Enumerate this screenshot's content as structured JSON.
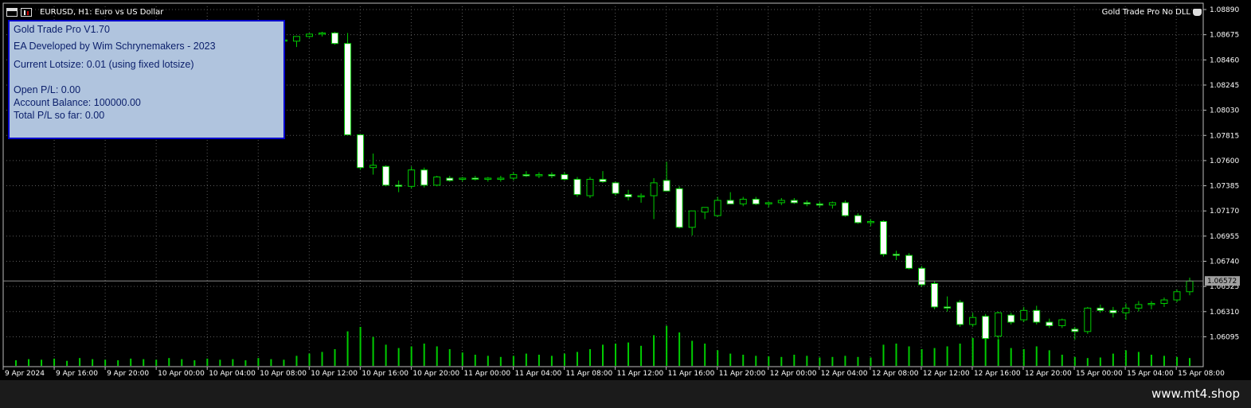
{
  "window": {
    "title": "EURUSD, H1:  Euro vs US Dollar",
    "ea_name": "Gold Trade Pro No DLL"
  },
  "panel": {
    "line1": "Gold Trade Pro V1.70",
    "line2": "EA Developed by Wim Schrynemakers - 2023",
    "line3": "Current Lotsize: 0.01 (using fixed lotsize)",
    "line4": "Open P/L: 0.00",
    "line5": "Account Balance: 100000.00",
    "line6": "Total P/L so far: 0.00"
  },
  "footer": {
    "site": "www.mt4.shop"
  },
  "colors": {
    "background": "#000000",
    "grid": "#5a5a5a",
    "bull": "#00cc00",
    "bear": "#ffffff",
    "panel": "#b0c4de",
    "panel_border": "#0000cc",
    "volume": "#00cc00"
  },
  "chart_data": {
    "type": "candlestick",
    "symbol": "EURUSD",
    "timeframe": "H1",
    "current_price": "1.06572",
    "y_ticks": [
      "1.08890",
      "1.08675",
      "1.08460",
      "1.08245",
      "1.08030",
      "1.07815",
      "1.07600",
      "1.07385",
      "1.07170",
      "1.06955",
      "1.06740",
      "1.06525",
      "1.06310",
      "1.06095"
    ],
    "x_labels": [
      "9 Apr 2024",
      "9 Apr 16:00",
      "9 Apr 20:00",
      "10 Apr 00:00",
      "10 Apr 04:00",
      "10 Apr 08:00",
      "10 Apr 12:00",
      "10 Apr 16:00",
      "10 Apr 20:00",
      "11 Apr 00:00",
      "11 Apr 04:00",
      "11 Apr 08:00",
      "11 Apr 12:00",
      "11 Apr 16:00",
      "11 Apr 20:00",
      "12 Apr 00:00",
      "12 Apr 04:00",
      "12 Apr 08:00",
      "12 Apr 12:00",
      "12 Apr 16:00",
      "12 Apr 20:00",
      "15 Apr 00:00",
      "15 Apr 04:00",
      "15 Apr 08:00"
    ],
    "ylim": [
      1.0598,
      1.0895
    ],
    "candles": [
      {
        "o": 1.0863,
        "h": 1.0865,
        "l": 1.086,
        "c": 1.0861
      },
      {
        "o": 1.0862,
        "h": 1.0864,
        "l": 1.086,
        "c": 1.0863
      },
      {
        "o": 1.0863,
        "h": 1.0866,
        "l": 1.0861,
        "c": 1.0862
      },
      {
        "o": 1.0862,
        "h": 1.0864,
        "l": 1.086,
        "c": 1.0863
      },
      {
        "o": 1.0863,
        "h": 1.0865,
        "l": 1.0861,
        "c": 1.0862
      },
      {
        "o": 1.0862,
        "h": 1.0864,
        "l": 1.086,
        "c": 1.0863
      },
      {
        "o": 1.0863,
        "h": 1.0865,
        "l": 1.0861,
        "c": 1.0862
      },
      {
        "o": 1.0862,
        "h": 1.0864,
        "l": 1.086,
        "c": 1.0863
      },
      {
        "o": 1.0863,
        "h": 1.0865,
        "l": 1.0861,
        "c": 1.0862
      },
      {
        "o": 1.0862,
        "h": 1.0864,
        "l": 1.086,
        "c": 1.0863
      },
      {
        "o": 1.0863,
        "h": 1.0865,
        "l": 1.0861,
        "c": 1.0862
      },
      {
        "o": 1.0862,
        "h": 1.0864,
        "l": 1.086,
        "c": 1.0863
      },
      {
        "o": 1.0863,
        "h": 1.0865,
        "l": 1.0861,
        "c": 1.0862
      },
      {
        "o": 1.0862,
        "h": 1.0864,
        "l": 1.086,
        "c": 1.0863
      },
      {
        "o": 1.0863,
        "h": 1.0865,
        "l": 1.0861,
        "c": 1.0862
      },
      {
        "o": 1.0862,
        "h": 1.0864,
        "l": 1.086,
        "c": 1.0863
      },
      {
        "o": 1.0863,
        "h": 1.0865,
        "l": 1.0861,
        "c": 1.0862
      },
      {
        "o": 1.0862,
        "h": 1.0864,
        "l": 1.086,
        "c": 1.0863
      },
      {
        "o": 1.0863,
        "h": 1.0865,
        "l": 1.0861,
        "c": 1.0862
      },
      {
        "o": 1.0862,
        "h": 1.0864,
        "l": 1.086,
        "c": 1.0863
      },
      {
        "o": 1.0863,
        "h": 1.0865,
        "l": 1.0861,
        "c": 1.0862
      },
      {
        "o": 1.0862,
        "h": 1.0864,
        "l": 1.086,
        "c": 1.0863
      },
      {
        "o": 1.0862,
        "h": 1.0866,
        "l": 1.0857,
        "c": 1.0866
      },
      {
        "o": 1.0866,
        "h": 1.0869,
        "l": 1.0865,
        "c": 1.0868
      },
      {
        "o": 1.0868,
        "h": 1.087,
        "l": 1.0866,
        "c": 1.0869
      },
      {
        "o": 1.0869,
        "h": 1.087,
        "l": 1.0859,
        "c": 1.086
      },
      {
        "o": 1.086,
        "h": 1.0869,
        "l": 1.0782,
        "c": 1.0782
      },
      {
        "o": 1.0782,
        "h": 1.0782,
        "l": 1.0752,
        "c": 1.0754
      },
      {
        "o": 1.0754,
        "h": 1.0766,
        "l": 1.0748,
        "c": 1.0756
      },
      {
        "o": 1.0755,
        "h": 1.0756,
        "l": 1.0738,
        "c": 1.0739
      },
      {
        "o": 1.0739,
        "h": 1.0743,
        "l": 1.0733,
        "c": 1.0738
      },
      {
        "o": 1.0738,
        "h": 1.0755,
        "l": 1.0736,
        "c": 1.0752
      },
      {
        "o": 1.0752,
        "h": 1.0754,
        "l": 1.0737,
        "c": 1.0739
      },
      {
        "o": 1.0739,
        "h": 1.0747,
        "l": 1.0738,
        "c": 1.0746
      },
      {
        "o": 1.0745,
        "h": 1.0747,
        "l": 1.0742,
        "c": 1.0743
      },
      {
        "o": 1.0744,
        "h": 1.0746,
        "l": 1.0742,
        "c": 1.0745
      },
      {
        "o": 1.0745,
        "h": 1.0747,
        "l": 1.0743,
        "c": 1.0744
      },
      {
        "o": 1.0744,
        "h": 1.0746,
        "l": 1.0742,
        "c": 1.0745
      },
      {
        "o": 1.0744,
        "h": 1.0747,
        "l": 1.0742,
        "c": 1.0745
      },
      {
        "o": 1.0745,
        "h": 1.075,
        "l": 1.0743,
        "c": 1.0748
      },
      {
        "o": 1.0748,
        "h": 1.0751,
        "l": 1.0746,
        "c": 1.0747
      },
      {
        "o": 1.0747,
        "h": 1.075,
        "l": 1.0745,
        "c": 1.0748
      },
      {
        "o": 1.0748,
        "h": 1.075,
        "l": 1.0745,
        "c": 1.0747
      },
      {
        "o": 1.0748,
        "h": 1.075,
        "l": 1.0743,
        "c": 1.0744
      },
      {
        "o": 1.0744,
        "h": 1.0746,
        "l": 1.0729,
        "c": 1.0731
      },
      {
        "o": 1.073,
        "h": 1.0746,
        "l": 1.0728,
        "c": 1.0744
      },
      {
        "o": 1.0744,
        "h": 1.0751,
        "l": 1.0741,
        "c": 1.0742
      },
      {
        "o": 1.0741,
        "h": 1.0742,
        "l": 1.073,
        "c": 1.0732
      },
      {
        "o": 1.0731,
        "h": 1.0735,
        "l": 1.0726,
        "c": 1.0729
      },
      {
        "o": 1.0729,
        "h": 1.0732,
        "l": 1.0724,
        "c": 1.073
      },
      {
        "o": 1.073,
        "h": 1.0745,
        "l": 1.071,
        "c": 1.0741
      },
      {
        "o": 1.0743,
        "h": 1.0759,
        "l": 1.0735,
        "c": 1.0734
      },
      {
        "o": 1.0736,
        "h": 1.0738,
        "l": 1.0702,
        "c": 1.0703
      },
      {
        "o": 1.0703,
        "h": 1.0716,
        "l": 1.0696,
        "c": 1.0717
      },
      {
        "o": 1.0716,
        "h": 1.0718,
        "l": 1.071,
        "c": 1.072
      },
      {
        "o": 1.0713,
        "h": 1.0729,
        "l": 1.0712,
        "c": 1.0726
      },
      {
        "o": 1.0726,
        "h": 1.0733,
        "l": 1.0723,
        "c": 1.0723
      },
      {
        "o": 1.0723,
        "h": 1.0729,
        "l": 1.0721,
        "c": 1.0727
      },
      {
        "o": 1.0727,
        "h": 1.0729,
        "l": 1.0722,
        "c": 1.0723
      },
      {
        "o": 1.0723,
        "h": 1.0725,
        "l": 1.072,
        "c": 1.0724
      },
      {
        "o": 1.0724,
        "h": 1.0728,
        "l": 1.0722,
        "c": 1.0726
      },
      {
        "o": 1.0726,
        "h": 1.0728,
        "l": 1.0723,
        "c": 1.0724
      },
      {
        "o": 1.0724,
        "h": 1.0726,
        "l": 1.0721,
        "c": 1.0723
      },
      {
        "o": 1.0723,
        "h": 1.0725,
        "l": 1.072,
        "c": 1.0722
      },
      {
        "o": 1.0722,
        "h": 1.0725,
        "l": 1.0719,
        "c": 1.0724
      },
      {
        "o": 1.0724,
        "h": 1.0726,
        "l": 1.0712,
        "c": 1.0713
      },
      {
        "o": 1.0713,
        "h": 1.0715,
        "l": 1.0706,
        "c": 1.0707
      },
      {
        "o": 1.0707,
        "h": 1.071,
        "l": 1.0704,
        "c": 1.0708
      },
      {
        "o": 1.0708,
        "h": 1.0709,
        "l": 1.0678,
        "c": 1.068
      },
      {
        "o": 1.068,
        "h": 1.0683,
        "l": 1.0675,
        "c": 1.0679
      },
      {
        "o": 1.0679,
        "h": 1.0681,
        "l": 1.0667,
        "c": 1.0668
      },
      {
        "o": 1.0668,
        "h": 1.067,
        "l": 1.0652,
        "c": 1.0654
      },
      {
        "o": 1.0655,
        "h": 1.0657,
        "l": 1.0633,
        "c": 1.0635
      },
      {
        "o": 1.0635,
        "h": 1.0644,
        "l": 1.0631,
        "c": 1.0634
      },
      {
        "o": 1.0639,
        "h": 1.0641,
        "l": 1.0618,
        "c": 1.062
      },
      {
        "o": 1.062,
        "h": 1.063,
        "l": 1.0618,
        "c": 1.0626
      },
      {
        "o": 1.0627,
        "h": 1.0629,
        "l": 1.0606,
        "c": 1.0608
      },
      {
        "o": 1.061,
        "h": 1.0631,
        "l": 1.0608,
        "c": 1.063
      },
      {
        "o": 1.0628,
        "h": 1.063,
        "l": 1.062,
        "c": 1.0622
      },
      {
        "o": 1.0624,
        "h": 1.0635,
        "l": 1.0622,
        "c": 1.0632
      },
      {
        "o": 1.0632,
        "h": 1.0636,
        "l": 1.062,
        "c": 1.0622
      },
      {
        "o": 1.0622,
        "h": 1.0625,
        "l": 1.0617,
        "c": 1.0619
      },
      {
        "o": 1.0619,
        "h": 1.0625,
        "l": 1.0617,
        "c": 1.0624
      },
      {
        "o": 1.0616,
        "h": 1.0618,
        "l": 1.0607,
        "c": 1.0614
      },
      {
        "o": 1.0614,
        "h": 1.0635,
        "l": 1.0612,
        "c": 1.0634
      },
      {
        "o": 1.0634,
        "h": 1.0637,
        "l": 1.063,
        "c": 1.0632
      },
      {
        "o": 1.0632,
        "h": 1.0635,
        "l": 1.0626,
        "c": 1.063
      },
      {
        "o": 1.063,
        "h": 1.0638,
        "l": 1.0624,
        "c": 1.0634
      },
      {
        "o": 1.0634,
        "h": 1.064,
        "l": 1.0631,
        "c": 1.0637
      },
      {
        "o": 1.0637,
        "h": 1.064,
        "l": 1.0633,
        "c": 1.0638
      },
      {
        "o": 1.0638,
        "h": 1.0643,
        "l": 1.0635,
        "c": 1.0641
      },
      {
        "o": 1.0641,
        "h": 1.065,
        "l": 1.0639,
        "c": 1.0648
      },
      {
        "o": 1.0648,
        "h": 1.066,
        "l": 1.0645,
        "c": 1.0657
      }
    ],
    "volumes": [
      10,
      12,
      11,
      13,
      9,
      14,
      12,
      11,
      10,
      13,
      12,
      11,
      14,
      12,
      10,
      13,
      11,
      12,
      10,
      14,
      12,
      11,
      18,
      22,
      25,
      30,
      62,
      70,
      52,
      38,
      32,
      35,
      40,
      35,
      30,
      24,
      20,
      18,
      16,
      18,
      22,
      20,
      18,
      22,
      25,
      30,
      38,
      40,
      42,
      36,
      55,
      72,
      60,
      45,
      40,
      28,
      22,
      20,
      18,
      17,
      16,
      20,
      18,
      15,
      16,
      18,
      16,
      15,
      38,
      40,
      35,
      30,
      32,
      35,
      40,
      50,
      52,
      48,
      32,
      30,
      35,
      28,
      20,
      16,
      14,
      15,
      22,
      28,
      25,
      20,
      18,
      16,
      14,
      18
    ]
  }
}
